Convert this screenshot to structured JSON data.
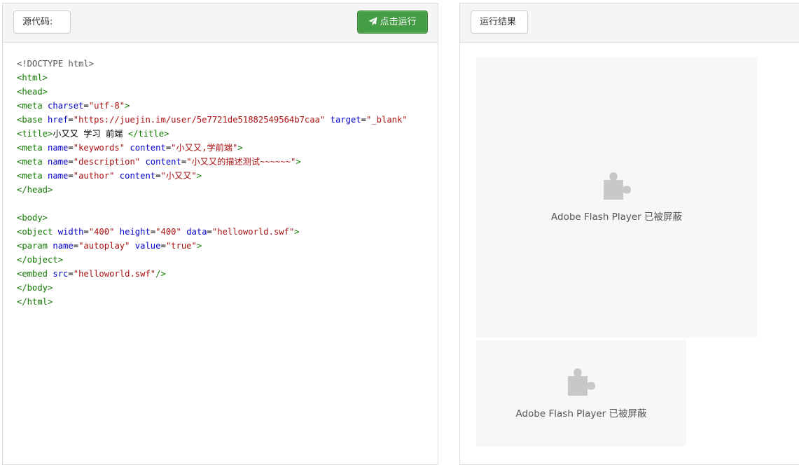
{
  "left_panel": {
    "label": "源代码:",
    "run_button": "点击运行"
  },
  "right_panel": {
    "label": "运行结果"
  },
  "code_lines": [
    [
      {
        "t": "<!DOCTYPE html>",
        "c": "meta"
      }
    ],
    [
      {
        "t": "<html>",
        "c": "tag"
      }
    ],
    [
      {
        "t": "<head>",
        "c": "tag"
      }
    ],
    [
      {
        "t": "<meta",
        "c": "tag"
      },
      {
        "t": " ",
        "c": "txt"
      },
      {
        "t": "charset",
        "c": "attr"
      },
      {
        "t": "=",
        "c": "txt"
      },
      {
        "t": "\"utf-8\"",
        "c": "str"
      },
      {
        "t": ">",
        "c": "tag"
      }
    ],
    [
      {
        "t": "<base",
        "c": "tag"
      },
      {
        "t": " ",
        "c": "txt"
      },
      {
        "t": "href",
        "c": "attr"
      },
      {
        "t": "=",
        "c": "txt"
      },
      {
        "t": "\"https://juejin.im/user/5e7721de51882549564b7caa\"",
        "c": "str"
      },
      {
        "t": " ",
        "c": "txt"
      },
      {
        "t": "target",
        "c": "attr"
      },
      {
        "t": "=",
        "c": "txt"
      },
      {
        "t": "\"_blank\"",
        "c": "str"
      }
    ],
    [
      {
        "t": "<title>",
        "c": "tag"
      },
      {
        "t": "小又又 学习 前端 ",
        "c": "txt"
      },
      {
        "t": "</title>",
        "c": "tag"
      }
    ],
    [
      {
        "t": "<meta",
        "c": "tag"
      },
      {
        "t": " ",
        "c": "txt"
      },
      {
        "t": "name",
        "c": "attr"
      },
      {
        "t": "=",
        "c": "txt"
      },
      {
        "t": "\"keywords\"",
        "c": "str"
      },
      {
        "t": " ",
        "c": "txt"
      },
      {
        "t": "content",
        "c": "attr"
      },
      {
        "t": "=",
        "c": "txt"
      },
      {
        "t": "\"小又又,学前端\"",
        "c": "str"
      },
      {
        "t": ">",
        "c": "tag"
      }
    ],
    [
      {
        "t": "<meta",
        "c": "tag"
      },
      {
        "t": " ",
        "c": "txt"
      },
      {
        "t": "name",
        "c": "attr"
      },
      {
        "t": "=",
        "c": "txt"
      },
      {
        "t": "\"description\"",
        "c": "str"
      },
      {
        "t": " ",
        "c": "txt"
      },
      {
        "t": "content",
        "c": "attr"
      },
      {
        "t": "=",
        "c": "txt"
      },
      {
        "t": "\"小又又的描述测试~~~~~~\"",
        "c": "str"
      },
      {
        "t": ">",
        "c": "tag"
      }
    ],
    [
      {
        "t": "<meta",
        "c": "tag"
      },
      {
        "t": " ",
        "c": "txt"
      },
      {
        "t": "name",
        "c": "attr"
      },
      {
        "t": "=",
        "c": "txt"
      },
      {
        "t": "\"author\"",
        "c": "str"
      },
      {
        "t": " ",
        "c": "txt"
      },
      {
        "t": "content",
        "c": "attr"
      },
      {
        "t": "=",
        "c": "txt"
      },
      {
        "t": "\"小又又\"",
        "c": "str"
      },
      {
        "t": ">",
        "c": "tag"
      }
    ],
    [
      {
        "t": "</head>",
        "c": "tag"
      }
    ],
    [],
    [
      {
        "t": "<body>",
        "c": "tag"
      }
    ],
    [
      {
        "t": "<object",
        "c": "tag"
      },
      {
        "t": " ",
        "c": "txt"
      },
      {
        "t": "width",
        "c": "attr"
      },
      {
        "t": "=",
        "c": "txt"
      },
      {
        "t": "\"400\"",
        "c": "str"
      },
      {
        "t": " ",
        "c": "txt"
      },
      {
        "t": "height",
        "c": "attr"
      },
      {
        "t": "=",
        "c": "txt"
      },
      {
        "t": "\"400\"",
        "c": "str"
      },
      {
        "t": " ",
        "c": "txt"
      },
      {
        "t": "data",
        "c": "attr"
      },
      {
        "t": "=",
        "c": "txt"
      },
      {
        "t": "\"helloworld.swf\"",
        "c": "str"
      },
      {
        "t": ">",
        "c": "tag"
      }
    ],
    [
      {
        "t": "<param",
        "c": "tag"
      },
      {
        "t": " ",
        "c": "txt"
      },
      {
        "t": "name",
        "c": "attr"
      },
      {
        "t": "=",
        "c": "txt"
      },
      {
        "t": "\"autoplay\"",
        "c": "str"
      },
      {
        "t": " ",
        "c": "txt"
      },
      {
        "t": "value",
        "c": "attr"
      },
      {
        "t": "=",
        "c": "txt"
      },
      {
        "t": "\"true\"",
        "c": "str"
      },
      {
        "t": ">",
        "c": "tag"
      }
    ],
    [
      {
        "t": "</object>",
        "c": "tag"
      }
    ],
    [
      {
        "t": "<embed",
        "c": "tag"
      },
      {
        "t": " ",
        "c": "txt"
      },
      {
        "t": "src",
        "c": "attr"
      },
      {
        "t": "=",
        "c": "txt"
      },
      {
        "t": "\"helloworld.swf\"",
        "c": "str"
      },
      {
        "t": "/>",
        "c": "tag"
      }
    ],
    [
      {
        "t": "</body>",
        "c": "tag"
      }
    ],
    [
      {
        "t": "</html>",
        "c": "tag"
      }
    ]
  ],
  "results": {
    "flash_blocked_text": "Adobe Flash Player 已被屏蔽",
    "puzzle_icon": "puzzle-piece-icon",
    "puzzle_color": "#c8c8c8"
  },
  "colors": {
    "run_button_bg": "#449d44",
    "syntax_tag": "#117700",
    "syntax_attr": "#0000cc",
    "syntax_string": "#aa1111",
    "syntax_meta": "#555555"
  }
}
